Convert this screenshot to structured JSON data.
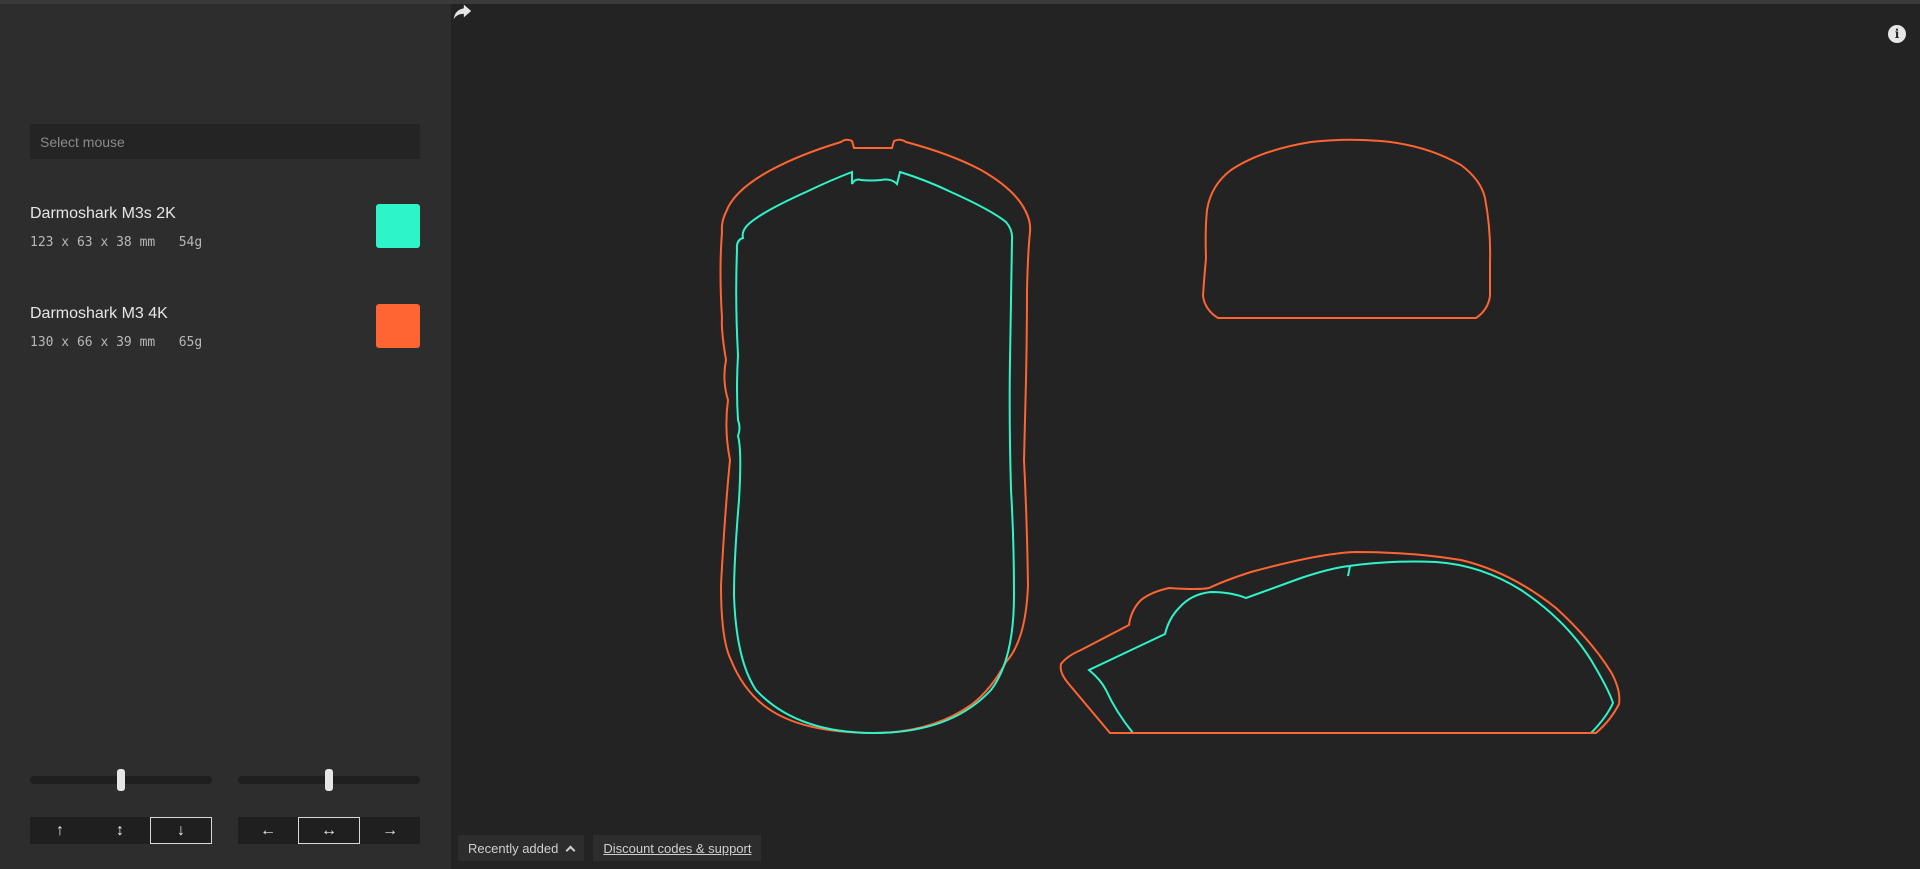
{
  "search": {
    "placeholder": "Select mouse"
  },
  "mice": [
    {
      "name": "Darmoshark M3s 2K",
      "dims": "123 x 63 x 38 mm",
      "weight": "54g",
      "color": "#2ef5c9"
    },
    {
      "name": "Darmoshark M3 4K",
      "dims": "130 x 66 x 39 mm",
      "weight": "65g",
      "color": "#ff6433"
    }
  ],
  "vertical_controls": {
    "slider_value": 0.5,
    "buttons": [
      "↑",
      "↕",
      "↓"
    ],
    "active": "↓"
  },
  "horizontal_controls": {
    "slider_value": 0.5,
    "buttons": [
      "←",
      "↔",
      "→"
    ],
    "active": "↔"
  },
  "top_icons": [
    "info-icon",
    "share-icon"
  ],
  "bottom": {
    "recent_label": "Recently added",
    "discount_label": "Discount codes & support"
  },
  "colors": {
    "sidebar_bg": "#2d2d2d",
    "canvas_bg": "#232323",
    "mouse_a": "#2ef5c9",
    "mouse_b": "#ff6433"
  }
}
